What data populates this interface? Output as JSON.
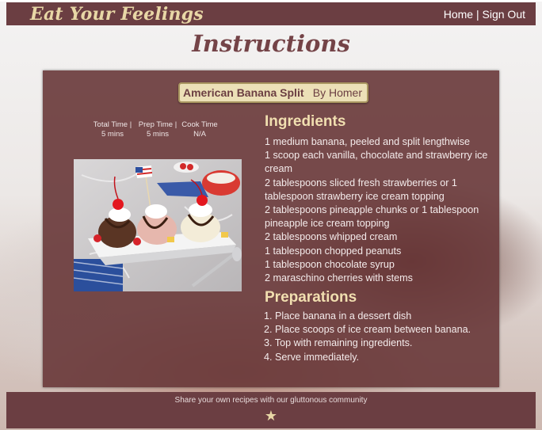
{
  "header": {
    "logo": "Eat Your Feelings",
    "nav_home": "Home",
    "nav_sep": " | ",
    "nav_signout": "Sign Out"
  },
  "page": {
    "title": "Instructions"
  },
  "recipe": {
    "name": "American Banana Split",
    "author": "By Homer",
    "times": [
      {
        "label": "Total Time |",
        "value": "5 mins"
      },
      {
        "label": "Prep Time |",
        "value": "5 mins"
      },
      {
        "label": "Cook Time",
        "value": "N/A"
      }
    ],
    "ingredients_heading": "Ingredients",
    "ingredients": [
      "1 medium banana, peeled  and split lengthwise",
      "1 scoop each vanilla, chocolate and strawberry ice cream",
      "2 tablespoons sliced fresh strawberries or 1 tablespoon strawberry ice cream topping",
      "2 tablespoons pineapple chunks or 1 tablespoon pineapple ice cream topping",
      "2 tablespoons whipped cream",
      "1 tablespoon chopped peanuts",
      "1 tablespoon chocolate syrup",
      "2 maraschino cherries with stems"
    ],
    "preparations_heading": "Preparations",
    "preparations": [
      "1. Place banana in a dessert dish",
      "2. Place scoops of ice cream between banana.",
      "3. Top with remaining ingredients.",
      "4. Serve immediately."
    ]
  },
  "footer": {
    "text": "Share your own recipes with our gluttonous community",
    "star": "★"
  },
  "colors": {
    "header_bg": "#6b3e42",
    "card_bg": "#683739",
    "accent_gold": "#e8d7a6"
  }
}
